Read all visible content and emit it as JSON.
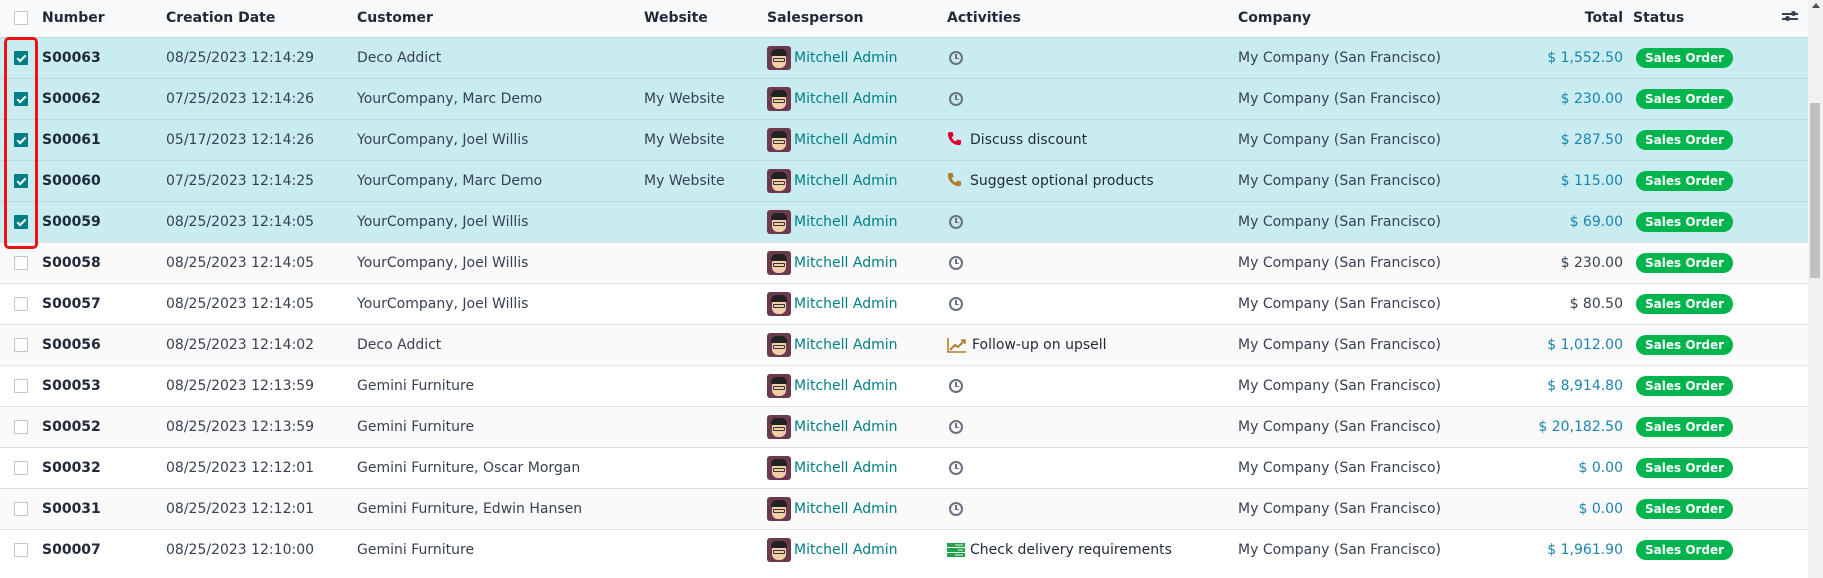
{
  "columns": {
    "number": "Number",
    "creation_date": "Creation Date",
    "customer": "Customer",
    "website": "Website",
    "salesperson": "Salesperson",
    "activities": "Activities",
    "company": "Company",
    "total": "Total",
    "status": "Status"
  },
  "icons": {
    "optional_columns": "sliders-icon",
    "activity_default": "clock-icon",
    "phone": "phone-icon",
    "upsell": "chart-line-icon",
    "delivery": "list-icon"
  },
  "colors": {
    "selected_row_bg": "#c8ecf0",
    "checkbox_checked": "#017e84",
    "salesperson_link": "#017e84",
    "total_teal": "#1b84b0",
    "status_badge": "#00b44e",
    "highlight_border": "#ee1111"
  },
  "rows": [
    {
      "selected": true,
      "number": "S00063",
      "date": "08/25/2023 12:14:29",
      "customer": "Deco Addict",
      "website": "",
      "salesperson": "Mitchell Admin",
      "activity": "",
      "activity_icon": "clock",
      "company": "My Company (San Francisco)",
      "total": "$ 1,552.50",
      "total_style": "teal",
      "status": "Sales Order"
    },
    {
      "selected": true,
      "number": "S00062",
      "date": "07/25/2023 12:14:26",
      "customer": "YourCompany, Marc Demo",
      "website": "My Website",
      "salesperson": "Mitchell Admin",
      "activity": "",
      "activity_icon": "clock",
      "company": "My Company (San Francisco)",
      "total": "$ 230.00",
      "total_style": "teal",
      "status": "Sales Order"
    },
    {
      "selected": true,
      "number": "S00061",
      "date": "05/17/2023 12:14:26",
      "customer": "YourCompany, Joel Willis",
      "website": "My Website",
      "salesperson": "Mitchell Admin",
      "activity": "Discuss discount",
      "activity_icon": "phone-red",
      "company": "My Company (San Francisco)",
      "total": "$ 287.50",
      "total_style": "teal",
      "status": "Sales Order"
    },
    {
      "selected": true,
      "number": "S00060",
      "date": "07/25/2023 12:14:25",
      "customer": "YourCompany, Marc Demo",
      "website": "My Website",
      "salesperson": "Mitchell Admin",
      "activity": "Suggest optional products",
      "activity_icon": "phone-brown",
      "company": "My Company (San Francisco)",
      "total": "$ 115.00",
      "total_style": "teal",
      "status": "Sales Order"
    },
    {
      "selected": true,
      "number": "S00059",
      "date": "08/25/2023 12:14:05",
      "customer": "YourCompany, Joel Willis",
      "website": "",
      "salesperson": "Mitchell Admin",
      "activity": "",
      "activity_icon": "clock",
      "company": "My Company (San Francisco)",
      "total": "$ 69.00",
      "total_style": "teal",
      "status": "Sales Order"
    },
    {
      "selected": false,
      "number": "S00058",
      "date": "08/25/2023 12:14:05",
      "customer": "YourCompany, Joel Willis",
      "website": "",
      "salesperson": "Mitchell Admin",
      "activity": "",
      "activity_icon": "clock",
      "company": "My Company (San Francisco)",
      "total": "$ 230.00",
      "total_style": "dark",
      "status": "Sales Order"
    },
    {
      "selected": false,
      "number": "S00057",
      "date": "08/25/2023 12:14:05",
      "customer": "YourCompany, Joel Willis",
      "website": "",
      "salesperson": "Mitchell Admin",
      "activity": "",
      "activity_icon": "clock",
      "company": "My Company (San Francisco)",
      "total": "$ 80.50",
      "total_style": "dark",
      "status": "Sales Order"
    },
    {
      "selected": false,
      "number": "S00056",
      "date": "08/25/2023 12:14:02",
      "customer": "Deco Addict",
      "website": "",
      "salesperson": "Mitchell Admin",
      "activity": "Follow-up on upsell",
      "activity_icon": "upsell",
      "company": "My Company (San Francisco)",
      "total": "$ 1,012.00",
      "total_style": "teal",
      "status": "Sales Order"
    },
    {
      "selected": false,
      "number": "S00053",
      "date": "08/25/2023 12:13:59",
      "customer": "Gemini Furniture",
      "website": "",
      "salesperson": "Mitchell Admin",
      "activity": "",
      "activity_icon": "clock",
      "company": "My Company (San Francisco)",
      "total": "$ 8,914.80",
      "total_style": "teal",
      "status": "Sales Order"
    },
    {
      "selected": false,
      "number": "S00052",
      "date": "08/25/2023 12:13:59",
      "customer": "Gemini Furniture",
      "website": "",
      "salesperson": "Mitchell Admin",
      "activity": "",
      "activity_icon": "clock",
      "company": "My Company (San Francisco)",
      "total": "$ 20,182.50",
      "total_style": "teal",
      "status": "Sales Order"
    },
    {
      "selected": false,
      "number": "S00032",
      "date": "08/25/2023 12:12:01",
      "customer": "Gemini Furniture, Oscar Morgan",
      "website": "",
      "salesperson": "Mitchell Admin",
      "activity": "",
      "activity_icon": "clock",
      "company": "My Company (San Francisco)",
      "total": "$ 0.00",
      "total_style": "teal",
      "status": "Sales Order"
    },
    {
      "selected": false,
      "number": "S00031",
      "date": "08/25/2023 12:12:01",
      "customer": "Gemini Furniture, Edwin Hansen",
      "website": "",
      "salesperson": "Mitchell Admin",
      "activity": "",
      "activity_icon": "clock",
      "company": "My Company (San Francisco)",
      "total": "$ 0.00",
      "total_style": "teal",
      "status": "Sales Order"
    },
    {
      "selected": false,
      "number": "S00007",
      "date": "08/25/2023 12:10:00",
      "customer": "Gemini Furniture",
      "website": "",
      "salesperson": "Mitchell Admin",
      "activity": "Check delivery requirements",
      "activity_icon": "delivery",
      "company": "My Company (San Francisco)",
      "total": "$ 1,961.90",
      "total_style": "teal",
      "status": "Sales Order"
    }
  ]
}
